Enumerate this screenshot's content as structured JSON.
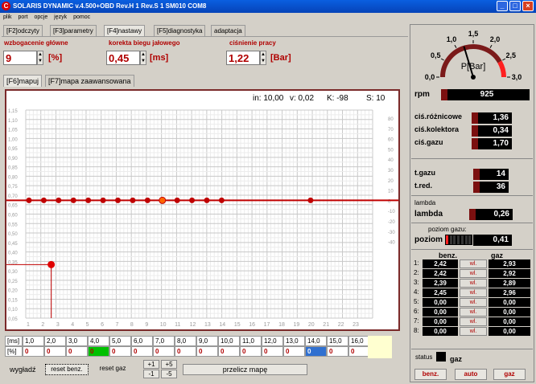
{
  "window": {
    "title": "SOLARIS DYNAMIC v.4.500+OBD Rev.H 1 Rev.S 1 SM010  COM8",
    "min": "_",
    "max": "□",
    "close": "×"
  },
  "menu": [
    "plik",
    "port",
    "opcje",
    "język",
    "pomoc"
  ],
  "tabs": [
    "[F2]odczyty",
    "[F3]parametry",
    "[F4]nastawy",
    "[F5]diagnostyka",
    "adaptacja"
  ],
  "fields": {
    "enrich": {
      "label": "wzbogacenie główne",
      "value": "9",
      "unit": "[%]"
    },
    "idle": {
      "label": "korekta biegu jałowego",
      "value": "0,45",
      "unit": "[ms]"
    },
    "pressure": {
      "label": "ciśnienie pracy",
      "value": "1,22",
      "unit": "[Bar]"
    }
  },
  "subtabs": [
    "[F6]mapuj",
    "[F7]mapa zaawansowana"
  ],
  "chart_info": {
    "in": "in: 10,00",
    "v": "v: 0,02",
    "k": "K: -98",
    "s": "S: 10"
  },
  "chart_data": {
    "type": "line",
    "y_left_ticks": [
      "1,15",
      "1,10",
      "1,05",
      "1,00",
      "0,95",
      "0,90",
      "0,85",
      "0,80",
      "0,75",
      "0,70",
      "0,65",
      "0,60",
      "0,55",
      "0,50",
      "0,45",
      "0,40",
      "0,35",
      "0,30",
      "0,25",
      "0,20",
      "0,15",
      "0,10",
      "0,05"
    ],
    "y_right_ticks": [
      "80",
      "70",
      "60",
      "50",
      "40",
      "30",
      "20",
      "10",
      "0",
      "-10",
      "-20",
      "-30",
      "-40"
    ],
    "x_ticks": [
      "1",
      "2",
      "3",
      "4",
      "5",
      "6",
      "7",
      "8",
      "9",
      "10",
      "11",
      "12",
      "13",
      "14",
      "15",
      "16",
      "17",
      "18",
      "19",
      "20",
      "21",
      "22",
      "23"
    ],
    "curve_points": [
      1,
      2,
      3,
      4,
      5,
      6,
      7,
      8,
      9,
      10,
      11,
      12,
      13,
      14,
      15,
      16,
      17,
      18,
      19,
      20,
      21,
      22,
      23
    ],
    "curve_y": 0,
    "markers_x": [
      1,
      2,
      3,
      4,
      5,
      6,
      7,
      8,
      9,
      10,
      11,
      12,
      13,
      14,
      20
    ],
    "highlight_x": 10,
    "point": {
      "x": 2.5,
      "y": 0.35
    }
  },
  "map_table": {
    "head_label": "[ms]",
    "row_label": "[%]",
    "ms": [
      "1,0",
      "2,0",
      "3,0",
      "4,0",
      "5,0",
      "6,0",
      "7,0",
      "8,0",
      "9,0",
      "10,0",
      "11,0",
      "12,0",
      "13,0",
      "14,0",
      "15,0",
      "16,0"
    ],
    "pct": [
      "0",
      "0",
      "0",
      "0",
      "0",
      "0",
      "0",
      "0",
      "0",
      "0",
      "0",
      "0",
      "0",
      "0",
      "0",
      "0"
    ]
  },
  "buttons": {
    "smooth": "wygładź",
    "reset_benz": "reset benz.",
    "reset_gaz": "reset gaz",
    "p1": "+1",
    "p5": "+5",
    "m1": "-1",
    "m5": "-5",
    "recalc": "przelicz mapę"
  },
  "gauge": {
    "label": "P[Bar]",
    "ticks": [
      "0,0",
      "0,5",
      "1,0",
      "1,5",
      "2,0",
      "2,5",
      "3,0"
    ],
    "value": 1.22
  },
  "rpm": {
    "label": "rpm",
    "value": "925"
  },
  "pressures": [
    {
      "label": "ciś.różnicowe",
      "value": "1,36"
    },
    {
      "label": "ciś.kolektora",
      "value": "0,34"
    },
    {
      "label": "ciś.gazu",
      "value": "1,70"
    }
  ],
  "temps": [
    {
      "label": "t.gazu",
      "value": "14"
    },
    {
      "label": "t.red.",
      "value": "36"
    }
  ],
  "lambda": {
    "group": "lambda",
    "label": "lambda",
    "value": "0,26"
  },
  "level": {
    "group": "poziom gazu:",
    "label": "poziom",
    "value": "0,41",
    "fraction": 0.1
  },
  "injectors": {
    "head_benz": "benz.",
    "head_gaz": "gaz",
    "wl": "wl.",
    "rows": [
      {
        "n": "1:",
        "benz": "2,42",
        "gaz": "2,93"
      },
      {
        "n": "2:",
        "benz": "2,42",
        "gaz": "2,92"
      },
      {
        "n": "3:",
        "benz": "2,39",
        "gaz": "2,89"
      },
      {
        "n": "4:",
        "benz": "2,45",
        "gaz": "2,96"
      },
      {
        "n": "5:",
        "benz": "0,00",
        "gaz": "0,00"
      },
      {
        "n": "6:",
        "benz": "0,00",
        "gaz": "0,00"
      },
      {
        "n": "7:",
        "benz": "0,00",
        "gaz": "0,00"
      },
      {
        "n": "8:",
        "benz": "0,00",
        "gaz": "0,00"
      }
    ]
  },
  "status": {
    "label": "status",
    "mode": "gaz"
  },
  "mode_buttons": [
    "benz.",
    "auto",
    "gaz"
  ]
}
